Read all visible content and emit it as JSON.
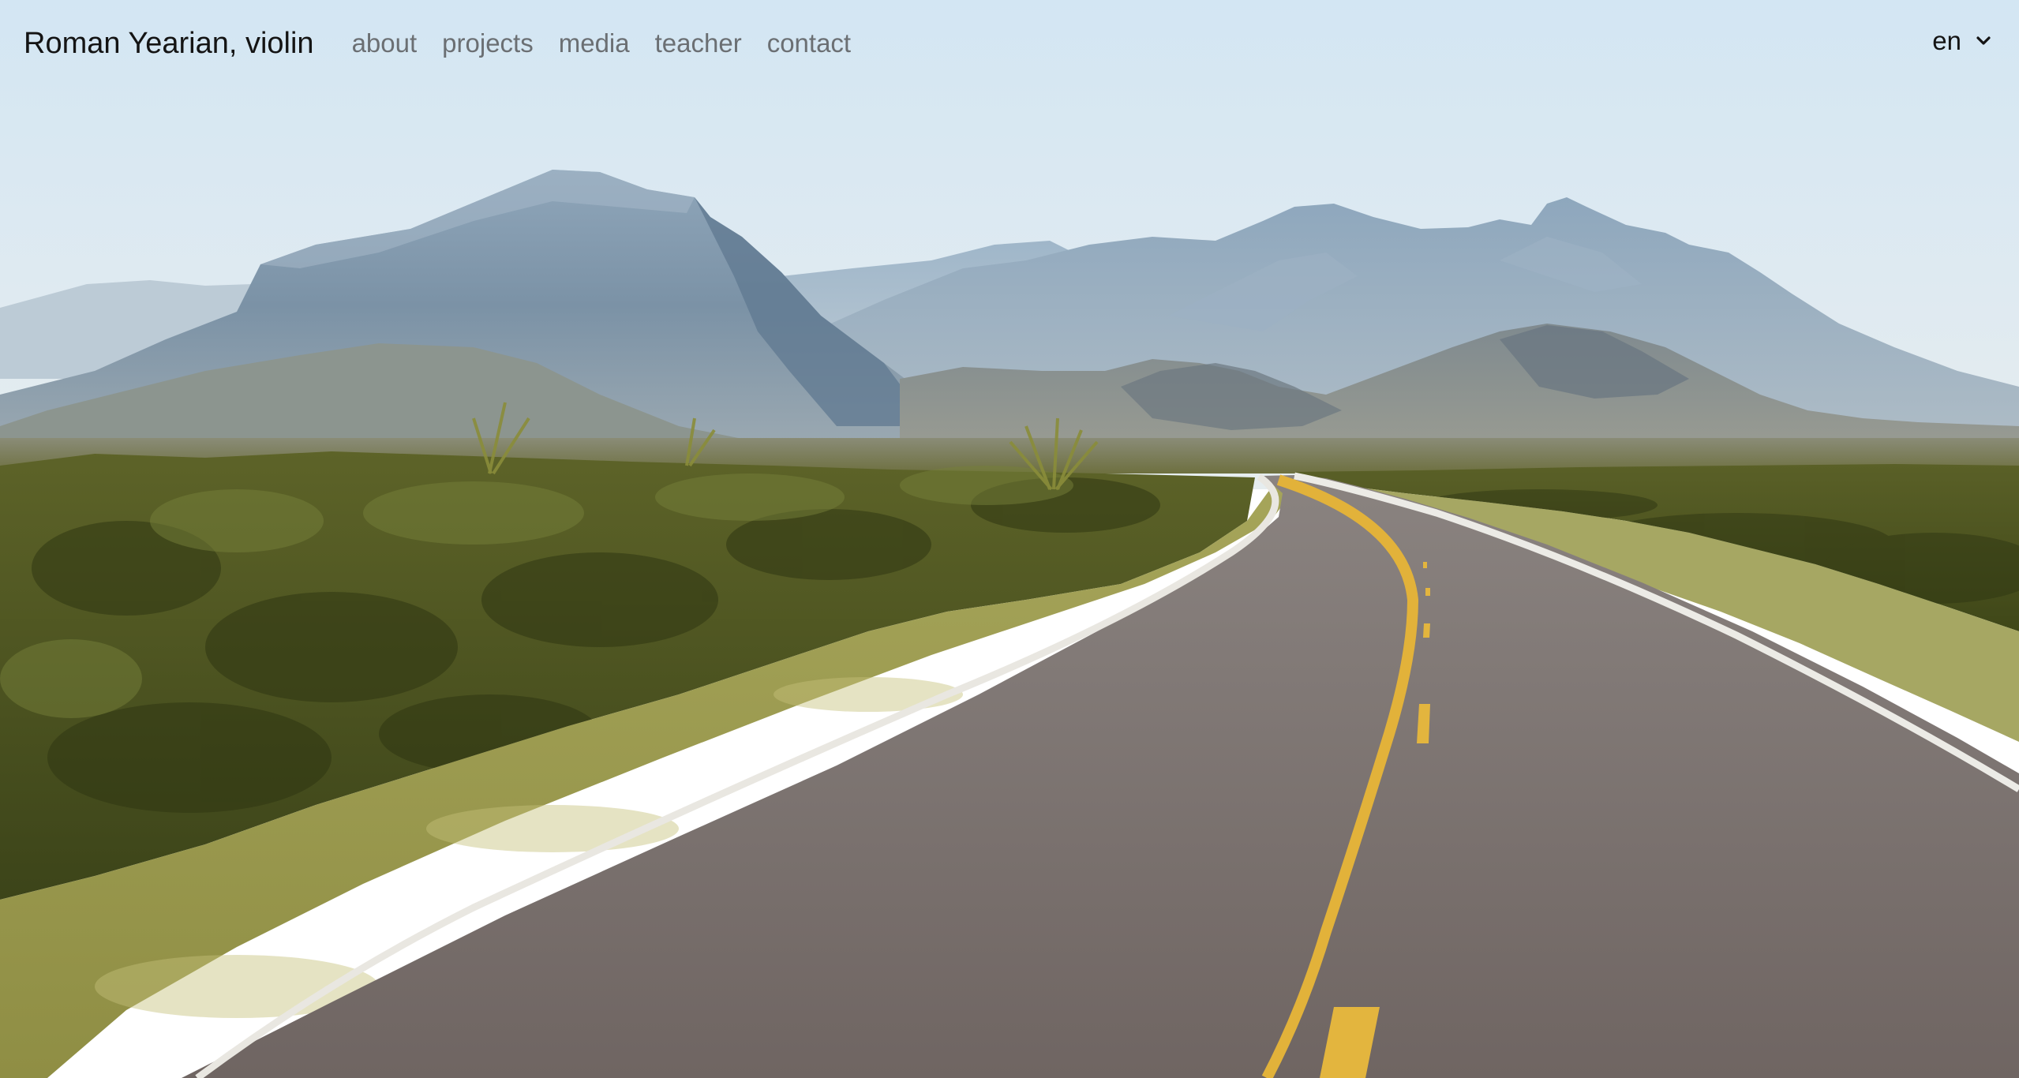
{
  "header": {
    "brand": "Roman Yearian, violin",
    "nav": [
      {
        "label": "about"
      },
      {
        "label": "projects"
      },
      {
        "label": "media"
      },
      {
        "label": "teacher"
      },
      {
        "label": "contact"
      }
    ],
    "language": {
      "selected": "en",
      "icon": "chevron-down-icon"
    }
  },
  "hero": {
    "image": "desert-road-mountains-photo"
  },
  "colors": {
    "brand_text": "#141414",
    "nav_text": "#6b6f73",
    "sky_top": "#d4e6f2",
    "road": "#7c7471",
    "lane_yellow": "#e2b23a",
    "shrub": "#4b521d"
  }
}
